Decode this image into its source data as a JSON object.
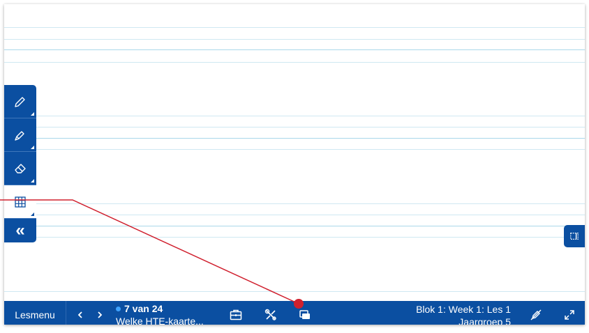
{
  "toolbar_left": {
    "tools": [
      {
        "name": "pencil-icon"
      },
      {
        "name": "marker-icon"
      },
      {
        "name": "eraser-icon"
      },
      {
        "name": "grid-icon",
        "active": true
      }
    ],
    "collapse_label": "«"
  },
  "bottom_bar": {
    "menu_label": "Lesmenu",
    "page_counter": "7 van 24",
    "slide_title": "Welke HTE-kaarte...",
    "lesson_line1": "Blok 1: Week 1: Les 1",
    "lesson_line2": "Jaargroep 5"
  },
  "colors": {
    "brand_blue": "#0b4fa1",
    "pointer_red": "#d0202e",
    "line_light": "#cfe8f2",
    "line_mid": "#a9d8ea"
  }
}
